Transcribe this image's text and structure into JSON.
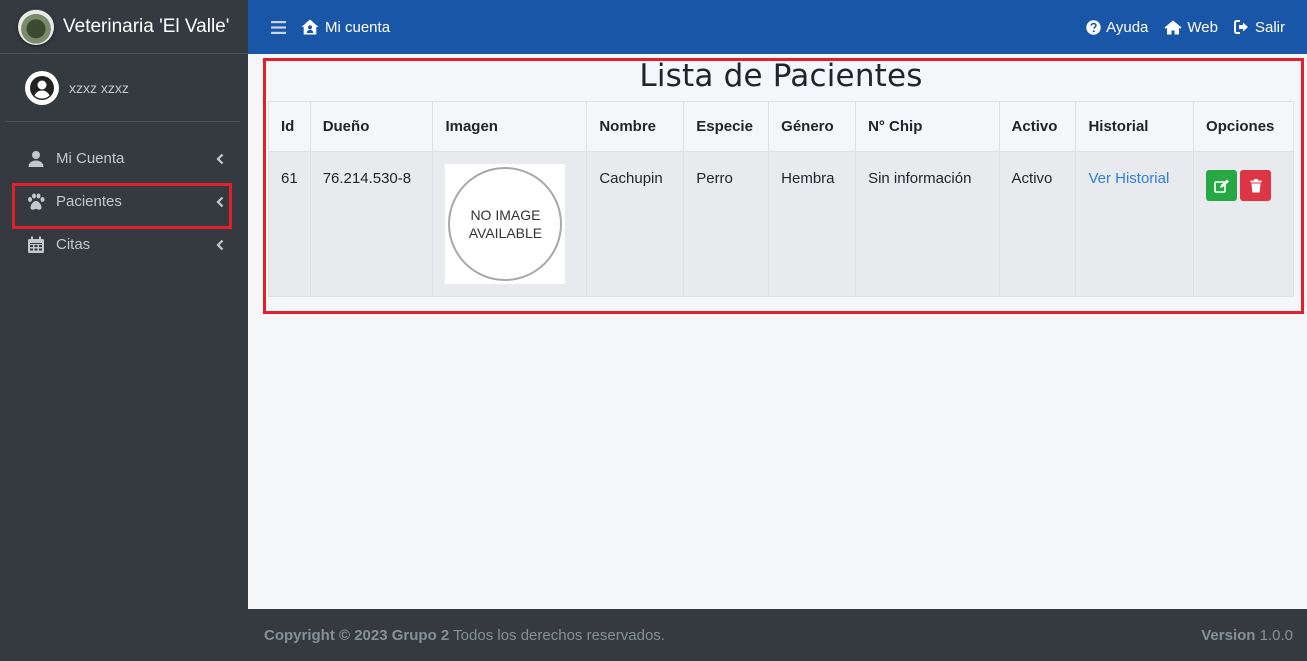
{
  "app": {
    "brand": "Veterinaria 'El Valle'",
    "user_name": "xzxz xzxz"
  },
  "sidebar": {
    "items": [
      {
        "label": "Mi Cuenta",
        "icon": "user-icon"
      },
      {
        "label": "Pacientes",
        "icon": "paw-icon"
      },
      {
        "label": "Citas",
        "icon": "calendar-icon"
      }
    ]
  },
  "header": {
    "account_label": "Mi cuenta",
    "help_label": "Ayuda",
    "web_label": "Web",
    "logout_label": "Salir"
  },
  "main": {
    "title": "Lista de Pacientes",
    "columns": [
      "Id",
      "Dueño",
      "Imagen",
      "Nombre",
      "Especie",
      "Género",
      "N° Chip",
      "Activo",
      "Historial",
      "Opciones"
    ],
    "rows": [
      {
        "id": "61",
        "owner": "76.214.530-8",
        "image_text_1": "NO IMAGE",
        "image_text_2": "AVAILABLE",
        "name": "Cachupin",
        "species": "Perro",
        "gender": "Hembra",
        "chip": "Sin información",
        "active": "Activo",
        "history_link": "Ver Historial"
      }
    ]
  },
  "footer": {
    "copyright": "Copyright © 2023 Grupo 2",
    "rights": "Todos los derechos reservados.",
    "version_label": "Version",
    "version": "1.0.0"
  },
  "colors": {
    "sidebar_bg": "#343a40",
    "header_bg": "#1a56a8",
    "highlight_border": "#e2202b",
    "edit_button": "#28a745",
    "delete_button": "#dc3545",
    "link": "#2f7fd8"
  }
}
